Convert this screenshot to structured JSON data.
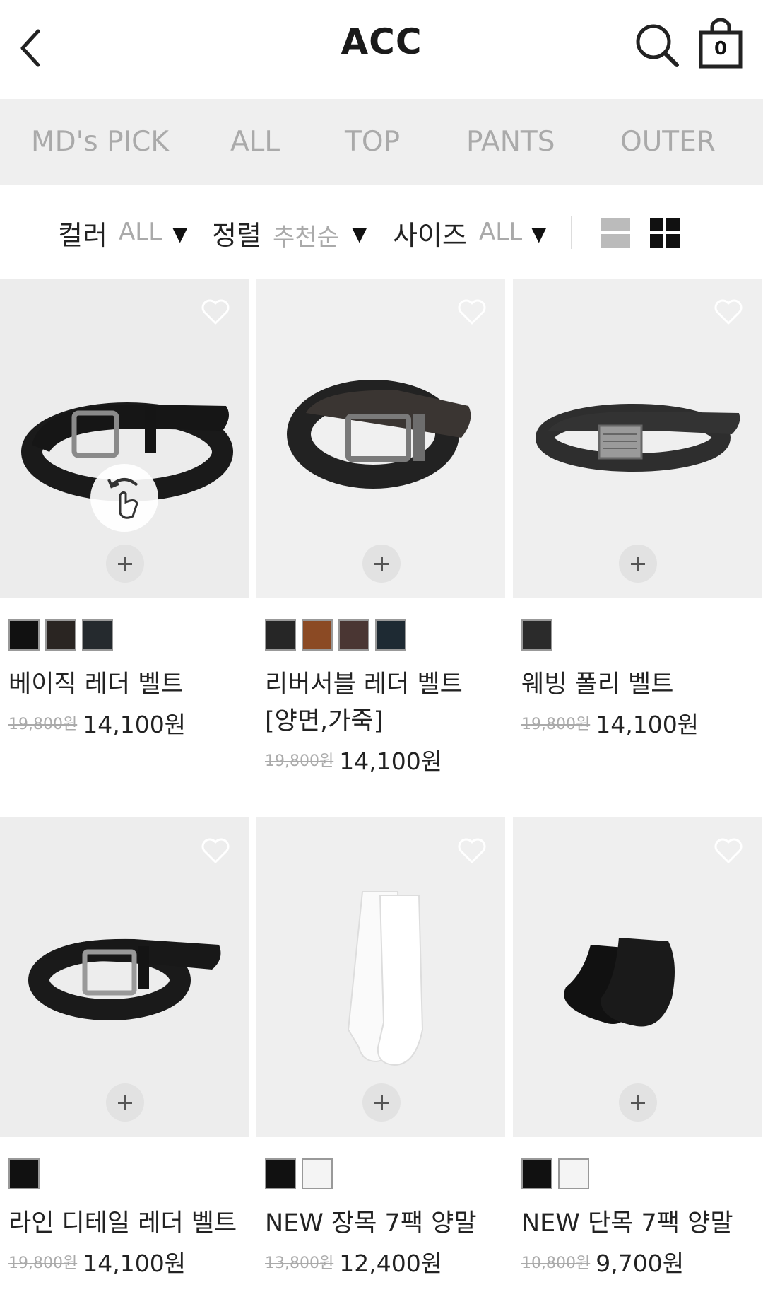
{
  "header": {
    "title": "ACC",
    "cart_count": "0"
  },
  "tabs": [
    "MD's PICK",
    "ALL",
    "TOP",
    "PANTS",
    "OUTER"
  ],
  "filters": {
    "color_label": "컬러",
    "color_value": "ALL",
    "sort_label": "정렬",
    "sort_value": "추천순",
    "size_label": "사이즈",
    "size_value": "ALL"
  },
  "products": [
    {
      "name": "베이직 레더 벨트",
      "original_price": "19,800원",
      "sale_price": "14,100원",
      "swatches": [
        "#111111",
        "#2a2522",
        "#252a2e"
      ],
      "image": "leather-belt-icon"
    },
    {
      "name": "리버서블 레더 벨트 [양면,가죽]",
      "original_price": "19,800원",
      "sale_price": "14,100원",
      "swatches": [
        "#262626",
        "#8b4a24",
        "#4a3633",
        "#1e2a33"
      ],
      "image": "reversible-belt-icon"
    },
    {
      "name": "웨빙 폴리 벨트",
      "original_price": "19,800원",
      "sale_price": "14,100원",
      "swatches": [
        "#2b2b2b"
      ],
      "image": "webbing-belt-icon"
    },
    {
      "name": "라인 디테일 레더 벨트",
      "original_price": "19,800원",
      "sale_price": "14,100원",
      "swatches": [
        "#111111"
      ],
      "image": "line-belt-icon"
    },
    {
      "name": "NEW 장목 7팩 양말",
      "original_price": "13,800원",
      "sale_price": "12,400원",
      "swatches": [
        "#111111",
        "#f4f4f4"
      ],
      "image": "crew-socks-icon"
    },
    {
      "name": "NEW 단목 7팩 양말",
      "original_price": "10,800원",
      "sale_price": "9,700원",
      "swatches": [
        "#111111",
        "#f4f4f4"
      ],
      "image": "ankle-socks-icon"
    }
  ]
}
